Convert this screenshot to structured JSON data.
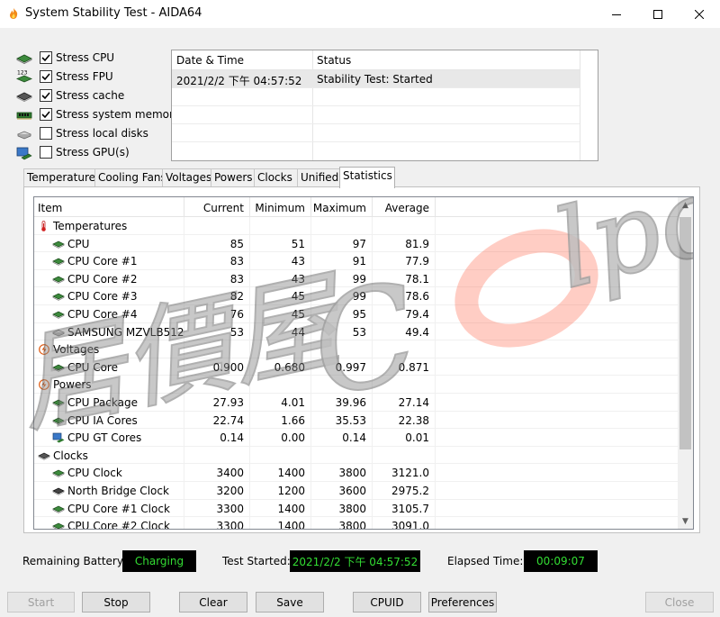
{
  "window": {
    "title": "System Stability Test - AIDA64"
  },
  "stress": [
    {
      "label": "Stress CPU",
      "checked": true,
      "icon": "cpu-chip-icon"
    },
    {
      "label": "Stress FPU",
      "checked": true,
      "icon": "fpu-123-icon"
    },
    {
      "label": "Stress cache",
      "checked": true,
      "icon": "cache-chip-icon"
    },
    {
      "label": "Stress system memory",
      "checked": true,
      "icon": "memory-module-icon"
    },
    {
      "label": "Stress local disks",
      "checked": false,
      "icon": "disk-drive-icon"
    },
    {
      "label": "Stress GPU(s)",
      "checked": false,
      "icon": "gpu-monitor-icon"
    }
  ],
  "log": {
    "headers": [
      "Date & Time",
      "Status"
    ],
    "rows": [
      {
        "datetime": "2021/2/2 下午 04:57:52",
        "status": "Stability Test: Started"
      }
    ]
  },
  "tabs": [
    "Temperatures",
    "Cooling Fans",
    "Voltages",
    "Powers",
    "Clocks",
    "Unified",
    "Statistics"
  ],
  "active_tab": "Statistics",
  "stats": {
    "headers": [
      "Item",
      "Current",
      "Minimum",
      "Maximum",
      "Average"
    ],
    "rows": [
      {
        "type": "group",
        "icon": "thermometer-icon",
        "item": "Temperatures"
      },
      {
        "type": "row",
        "icon": "cpu-chip-icon",
        "item": "CPU",
        "current": "85",
        "min": "51",
        "max": "97",
        "avg": "81.9"
      },
      {
        "type": "row",
        "icon": "cpu-chip-icon",
        "item": "CPU Core #1",
        "current": "83",
        "min": "43",
        "max": "91",
        "avg": "77.9"
      },
      {
        "type": "row",
        "icon": "cpu-chip-icon",
        "item": "CPU Core #2",
        "current": "83",
        "min": "43",
        "max": "99",
        "avg": "78.1"
      },
      {
        "type": "row",
        "icon": "cpu-chip-icon",
        "item": "CPU Core #3",
        "current": "82",
        "min": "45",
        "max": "99",
        "avg": "78.6"
      },
      {
        "type": "row",
        "icon": "cpu-chip-icon",
        "item": "CPU Core #4",
        "current": "76",
        "min": "45",
        "max": "95",
        "avg": "79.4"
      },
      {
        "type": "row",
        "icon": "disk-drive-icon",
        "item": "SAMSUNG MZVLB512...",
        "current": "53",
        "min": "44",
        "max": "53",
        "avg": "49.4"
      },
      {
        "type": "group",
        "icon": "voltage-icon",
        "item": "Voltages"
      },
      {
        "type": "row",
        "icon": "cpu-chip-icon",
        "item": "CPU Core",
        "current": "0.900",
        "min": "0.680",
        "max": "0.997",
        "avg": "0.871"
      },
      {
        "type": "group",
        "icon": "power-icon",
        "item": "Powers"
      },
      {
        "type": "row",
        "icon": "cpu-chip-icon",
        "item": "CPU Package",
        "current": "27.93",
        "min": "4.01",
        "max": "39.96",
        "avg": "27.14"
      },
      {
        "type": "row",
        "icon": "cpu-chip-icon",
        "item": "CPU IA Cores",
        "current": "22.74",
        "min": "1.66",
        "max": "35.53",
        "avg": "22.38"
      },
      {
        "type": "row",
        "icon": "gpu-monitor-icon",
        "item": "CPU GT Cores",
        "current": "0.14",
        "min": "0.00",
        "max": "0.14",
        "avg": "0.01"
      },
      {
        "type": "group",
        "icon": "clock-icon",
        "item": "Clocks"
      },
      {
        "type": "row",
        "icon": "cpu-chip-icon",
        "item": "CPU Clock",
        "current": "3400",
        "min": "1400",
        "max": "3800",
        "avg": "3121.0"
      },
      {
        "type": "row",
        "icon": "chipset-icon",
        "item": "North Bridge Clock",
        "current": "3200",
        "min": "1200",
        "max": "3600",
        "avg": "2975.2"
      },
      {
        "type": "row",
        "icon": "cpu-chip-icon",
        "item": "CPU Core #1 Clock",
        "current": "3300",
        "min": "1400",
        "max": "3800",
        "avg": "3105.7"
      },
      {
        "type": "row",
        "icon": "cpu-chip-icon",
        "item": "CPU Core #2 Clock",
        "current": "3300",
        "min": "1400",
        "max": "3800",
        "avg": "3091.0"
      }
    ]
  },
  "status": {
    "battery_label": "Remaining Battery:",
    "battery_value": "Charging",
    "started_label": "Test Started:",
    "started_value": "2021/2/2 下午 04:57:52",
    "elapsed_label": "Elapsed Time:",
    "elapsed_value": "00:09:07"
  },
  "buttons": {
    "start": "Start",
    "stop": "Stop",
    "clear": "Clear",
    "save": "Save",
    "cpuid": "CPUID",
    "preferences": "Preferences",
    "close": "Close"
  },
  "watermark": {
    "text": "居價屋C",
    "brand": "lpc"
  },
  "colors": {
    "status_text": "#33dd33",
    "status_bg": "#000000",
    "chip_green": "#3c8a3c",
    "watermark_red": "#ff5a3c"
  }
}
